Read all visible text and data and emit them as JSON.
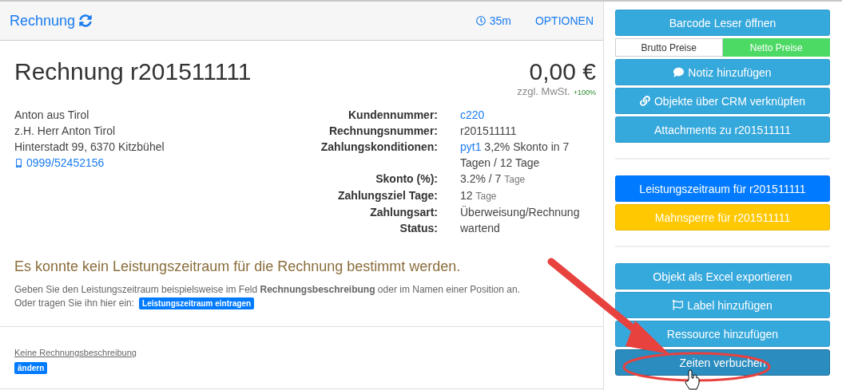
{
  "header": {
    "title": "Rechnung",
    "timer": "35m",
    "options": "OPTIONEN"
  },
  "invoice": {
    "title": "Rechnung r201511111",
    "amount": "0,00 €",
    "tax_note": "zzgl. MwSt.",
    "tax_rate": "+100%"
  },
  "address": [
    {
      "kind": "text",
      "text": "Anton aus Tirol"
    },
    {
      "kind": "text",
      "text": "z.H. Herr Anton Tirol"
    },
    {
      "kind": "text",
      "text": "Hinterstadt 99, 6370 Kitzbühel"
    },
    {
      "kind": "phone",
      "text": "0999/52452156"
    }
  ],
  "details": [
    {
      "label": "Kundennummer:",
      "link": "c220"
    },
    {
      "label": "Rechnungsnummer:",
      "value": "r201511111"
    },
    {
      "label": "Zahlungskonditionen:",
      "link": "pyt1",
      "value": "3,2% Skonto in 7 Tagen / 12 Tage"
    },
    {
      "label": "Skonto (%):",
      "value": "3.2% / 7",
      "unit": "Tage"
    },
    {
      "label": "Zahlungsziel Tage:",
      "value": "12",
      "unit": "Tage"
    },
    {
      "label": "Zahlungsart:",
      "value": "Überweisung/Rechnung"
    },
    {
      "label": "Status:",
      "value": "wartend"
    }
  ],
  "warning": {
    "heading": "Es konnte kein Leistungszeitraum für die Rechnung bestimmt werden.",
    "text": "Geben Sie den Leistungszeitraum beispielsweise im Feld **Rechnungsbeschreibung** oder im Namen einer Position an.",
    "prompt": "Oder tragen Sie ihn hier ein:",
    "button": "Leistungszeitraum eintragen"
  },
  "description": {
    "text": "Keine Rechnungsbeschreibung",
    "button": "ändern"
  },
  "sidebar": [
    [
      {
        "kind": "button",
        "label": "Barcode Leser öffnen",
        "color": "#35a8dc",
        "hovered": false
      },
      {
        "kind": "toggle",
        "options": [
          {
            "label": "Brutto Preise",
            "selected": false
          },
          {
            "label": "Netto Preise",
            "selected": true
          }
        ]
      },
      {
        "kind": "button",
        "label": "Notiz hinzufügen",
        "color": "#35a8dc",
        "hovered": false
      },
      {
        "kind": "button",
        "label": "Objekte über CRM verknüpfen",
        "color": "#35a8dc",
        "hovered": false
      },
      {
        "kind": "button",
        "label": "Attachments zu r201511111",
        "color": "#35a8dc",
        "hovered": false
      }
    ],
    [
      {
        "kind": "button",
        "label": "Leistungszeitraum für r201511111",
        "color": "#007bff",
        "hovered": false
      },
      {
        "kind": "button",
        "label": "Mahnsperre für r201511111",
        "color": "#ffc800",
        "hovered": false
      }
    ],
    [
      {
        "kind": "button",
        "label": "Objekt als Excel exportieren",
        "color": "#35a8dc",
        "hovered": false
      },
      {
        "kind": "button",
        "label": "Label hinzufügen",
        "color": "#35a8dc",
        "hovered": false
      },
      {
        "kind": "button",
        "label": "Ressource hinzufügen",
        "color": "#35a8dc",
        "hovered": false
      },
      {
        "kind": "button",
        "label": "Zeiten verbuchen",
        "color": "#2a8cbf",
        "hovered": true
      }
    ]
  ]
}
